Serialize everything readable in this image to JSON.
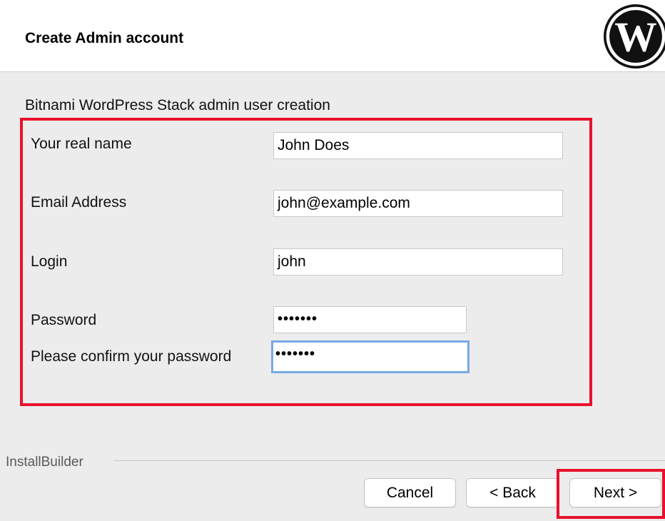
{
  "header": {
    "title": "Create Admin account",
    "logo_icon": "wordpress-logo-icon"
  },
  "form": {
    "subtitle": "Bitnami WordPress Stack admin user creation",
    "fields": [
      {
        "label": "Your real name",
        "value": "John Does"
      },
      {
        "label": "Email Address",
        "value": "john@example.com"
      },
      {
        "label": "Login",
        "value": "john"
      },
      {
        "label": "Password",
        "value": "•••••••"
      },
      {
        "label": "Please confirm your password",
        "value": "•••••••"
      }
    ]
  },
  "footer": {
    "brand": "InstallBuilder",
    "buttons": {
      "cancel": "Cancel",
      "back": "< Back",
      "next": "Next >"
    }
  },
  "colors": {
    "highlight": "#e8112d",
    "focus_ring": "#78a9e4",
    "panel_background": "#ececec"
  }
}
